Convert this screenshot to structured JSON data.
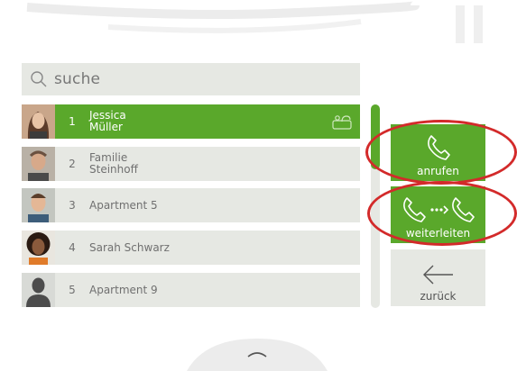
{
  "search": {
    "label": "suche",
    "icon": "search-icon"
  },
  "contacts": [
    {
      "number": "1",
      "name_line1": "Jessica",
      "name_line2": "Müller",
      "selected": true,
      "icon": "forward-indicator-icon"
    },
    {
      "number": "2",
      "name_line1": "Familie",
      "name_line2": "Steinhoff",
      "selected": false
    },
    {
      "number": "3",
      "name_line1": "Apartment 5",
      "name_line2": "",
      "selected": false
    },
    {
      "number": "4",
      "name_line1": "Sarah Schwarz",
      "name_line2": "",
      "selected": false
    },
    {
      "number": "5",
      "name_line1": "Apartment 9",
      "name_line2": "",
      "selected": false
    }
  ],
  "actions": {
    "call_label": "anrufen",
    "forward_label": "weiterleiten",
    "back_label": "zurück"
  },
  "colors": {
    "accent": "#5aa82b",
    "panel": "#e6e8e3",
    "highlight": "#d32a2a"
  }
}
